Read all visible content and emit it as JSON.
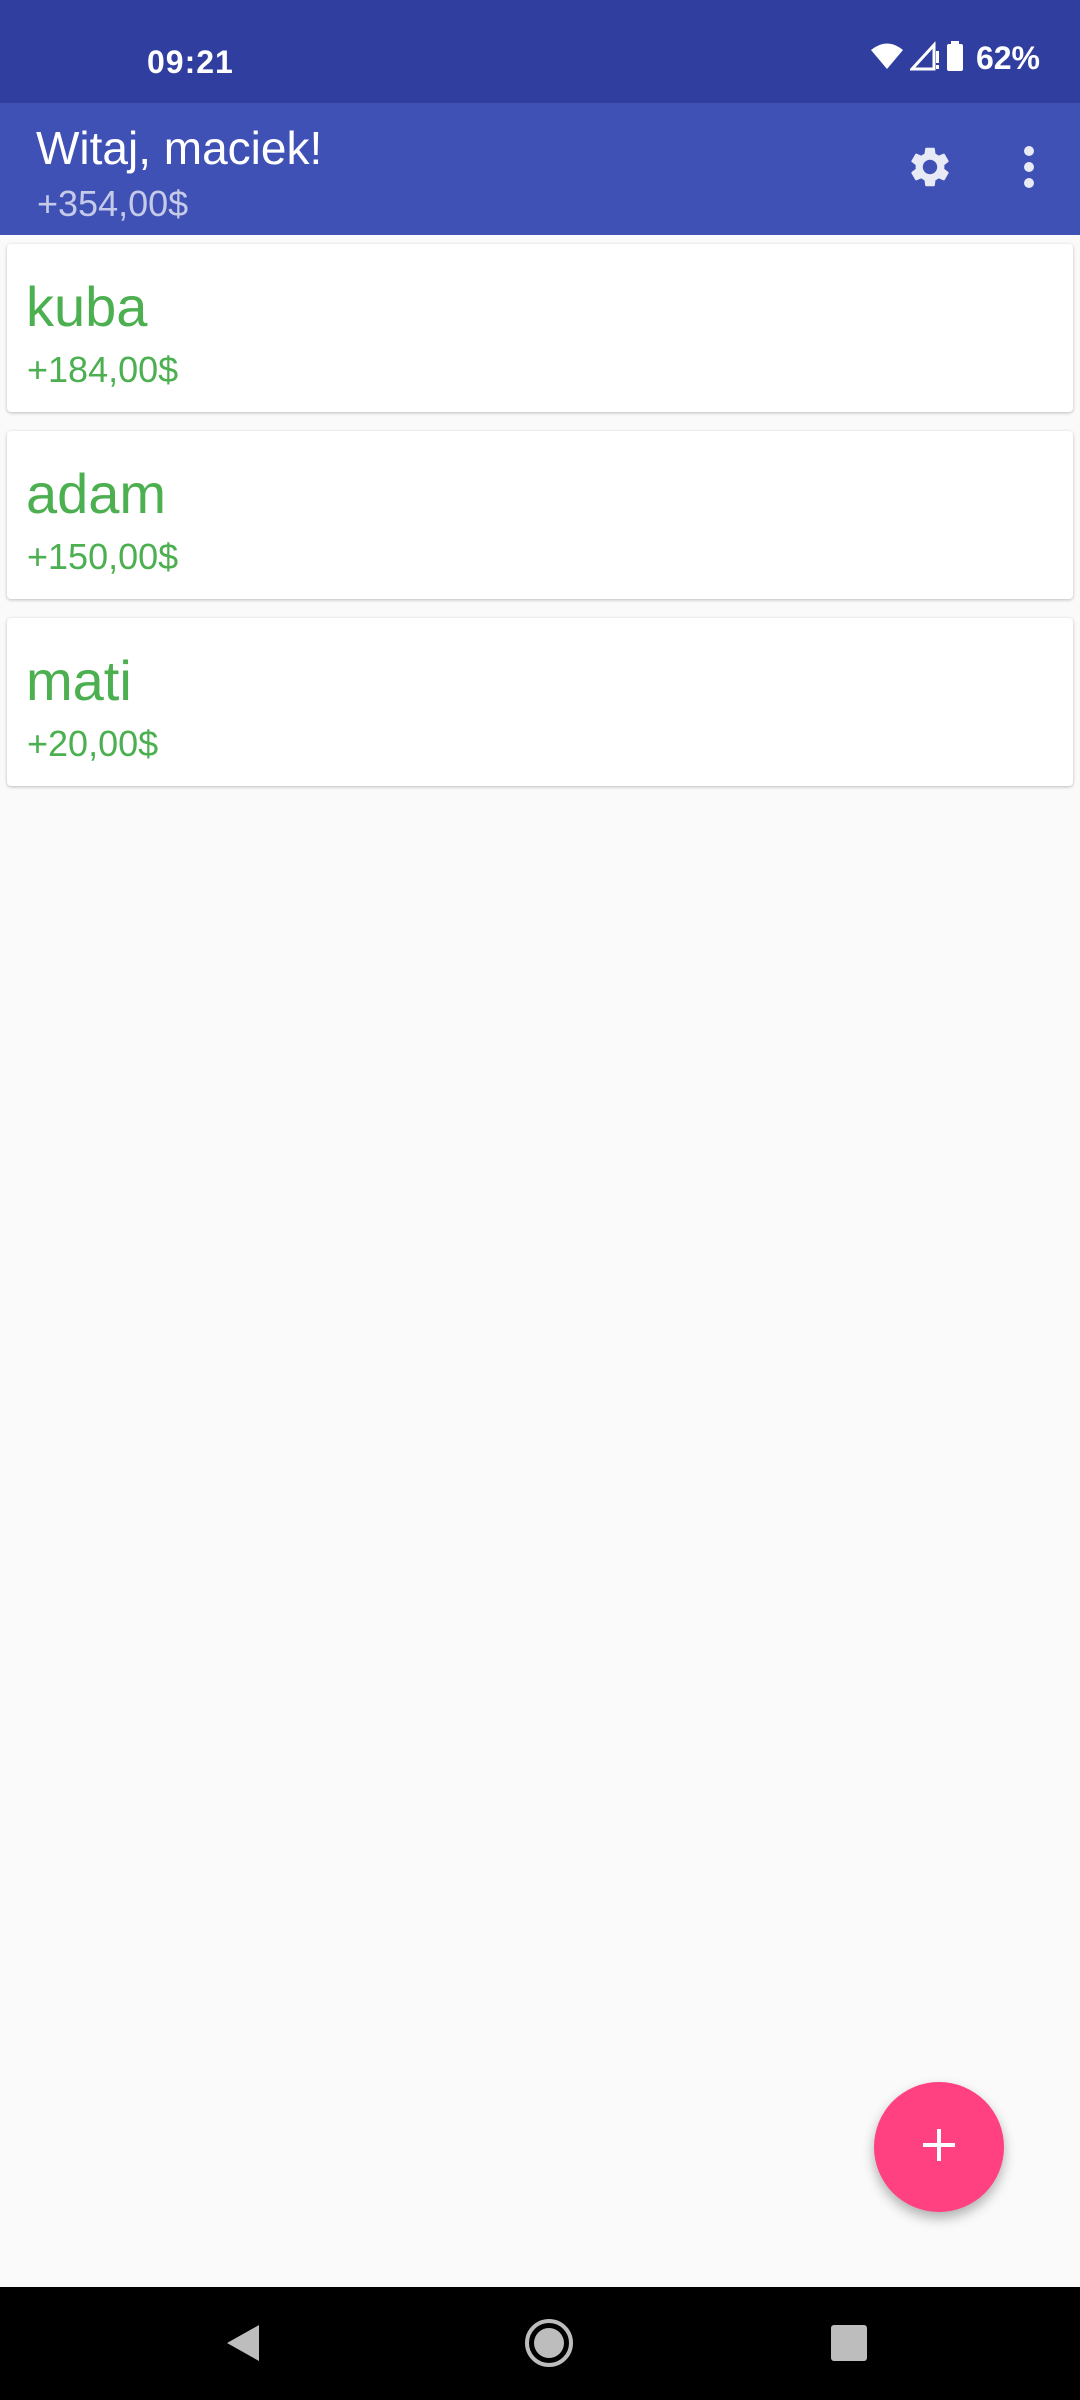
{
  "status_bar": {
    "time": "09:21",
    "battery": "62%",
    "icons": [
      "wifi-icon",
      "signal-icon",
      "battery-icon"
    ],
    "background": "#303f9f"
  },
  "app_bar": {
    "title": "Witaj, maciek!",
    "balance": "+354,00$",
    "actions": [
      "settings-icon",
      "more-vert-icon"
    ],
    "background": "#3f51b5"
  },
  "people": [
    {
      "name": "kuba",
      "amount": "+184,00$"
    },
    {
      "name": "adam",
      "amount": "+150,00$"
    },
    {
      "name": "mati",
      "amount": "+20,00$"
    }
  ],
  "colors": {
    "positive": "#4caf50",
    "fab": "#ff4081",
    "background": "#fafafa"
  },
  "fab": {
    "icon": "plus-icon"
  },
  "nav_bar": {
    "buttons": [
      "back-icon",
      "home-icon",
      "recents-icon"
    ]
  }
}
